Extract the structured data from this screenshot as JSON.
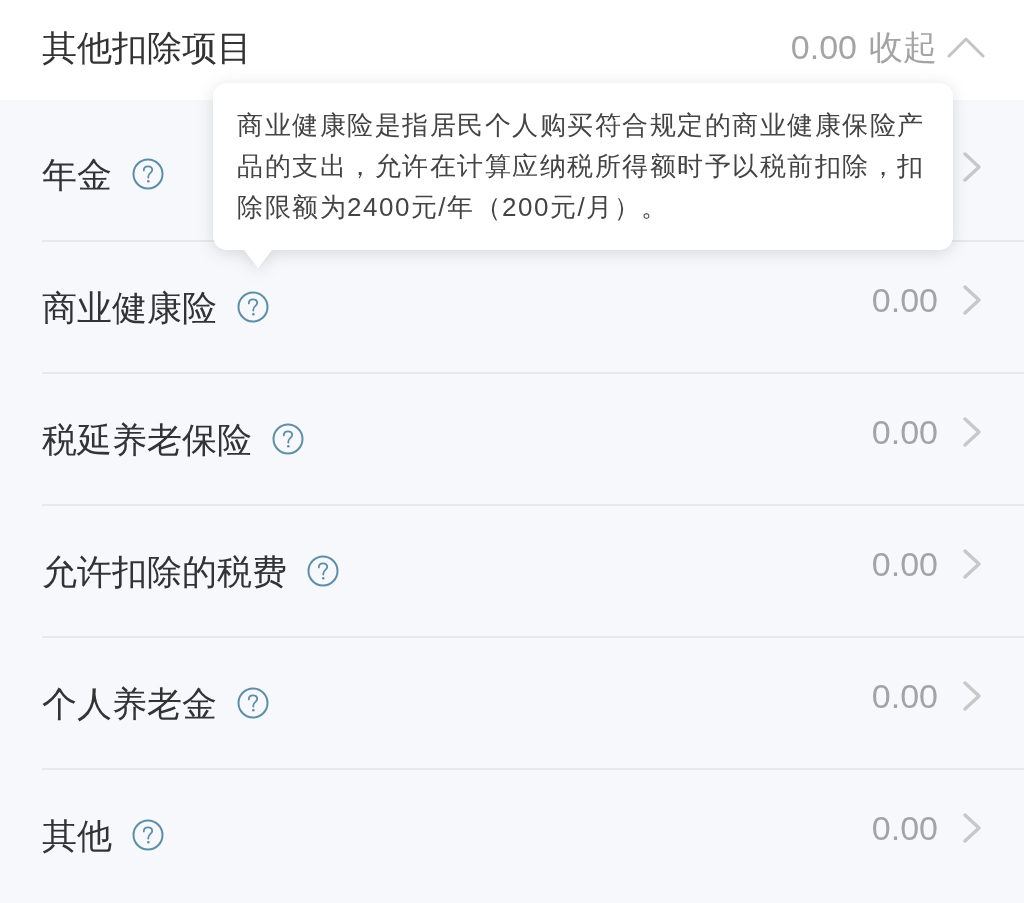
{
  "header": {
    "title": "其他扣除项目",
    "total": "0.00",
    "toggle_label": "收起",
    "expanded": true
  },
  "items": [
    {
      "label": "年金"
    },
    {
      "label": "商业健康险",
      "value": "0.00",
      "tooltip": "商业健康险是指居民个人购买符合规定的商业健康保险产品的支出，允许在计算应纳税所得额时予以税前扣除，扣除限额为2400元/年（200元/月）。"
    },
    {
      "label": "税延养老保险",
      "value": "0.00"
    },
    {
      "label": "允许扣除的税费",
      "value": "0.00"
    },
    {
      "label": "个人养老金",
      "value": "0.00"
    },
    {
      "label": "其他",
      "value": "0.00"
    }
  ]
}
